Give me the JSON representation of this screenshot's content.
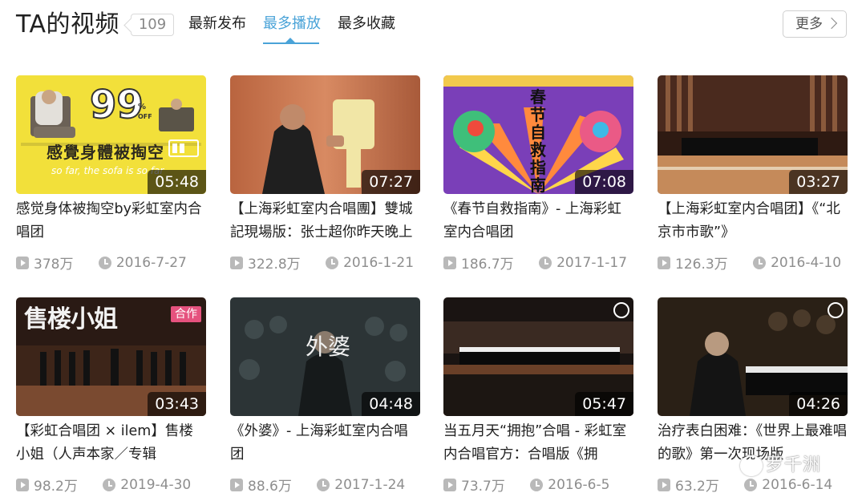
{
  "header": {
    "title": "TA的视频",
    "count": "109",
    "tabs": [
      {
        "label": "最新发布"
      },
      {
        "label": "最多播放"
      },
      {
        "label": "最多收藏"
      }
    ],
    "more_label": "更多"
  },
  "videos": [
    {
      "title": "感觉身体被掏空by彩虹室内合唱团",
      "duration": "05:48",
      "plays": "378万",
      "date": "2016-7-27",
      "thumb_text": {
        "big": "99",
        "pct": "%",
        "off": "OFF",
        "line": "感覺身體被掏空",
        "sub": "so far, the sofa is so far"
      }
    },
    {
      "title": "【上海彩虹室内合唱團】雙城記現場版：张士超你昨天晚上",
      "duration": "07:27",
      "plays": "322.8万",
      "date": "2016-1-21"
    },
    {
      "title": "《春节自救指南》- 上海彩虹室内合唱团",
      "duration": "07:08",
      "plays": "186.7万",
      "date": "2017-1-17",
      "thumb_text": {
        "line": "春节自救指南"
      }
    },
    {
      "title": "【上海彩虹室内合唱团】《“北京市市歌”》",
      "duration": "03:27",
      "plays": "126.3万",
      "date": "2016-4-10"
    },
    {
      "title": "【彩虹合唱团 × ilem】售楼小姐（人声本家／专辑",
      "duration": "03:43",
      "plays": "98.2万",
      "date": "2019-4-30",
      "badge": "合作",
      "thumb_text": {
        "line": "售楼小姐"
      }
    },
    {
      "title": "《外婆》- 上海彩虹室内合唱团",
      "duration": "04:48",
      "plays": "88.6万",
      "date": "2017-1-24",
      "thumb_text": {
        "line": "外婆"
      }
    },
    {
      "title": "当五月天“拥抱”合唱 - 彩虹室内合唱官方：合唱版《拥",
      "duration": "05:47",
      "plays": "73.7万",
      "date": "2016-6-5"
    },
    {
      "title": "治疗表白困难：《世界上最难唱的歌》第一次现场版",
      "duration": "04:26",
      "plays": "63.2万",
      "date": "2016-6-14"
    }
  ],
  "watermark": "罗千洲",
  "colors": {
    "accent": "#4aa3d8",
    "badge": "#e5527e"
  }
}
